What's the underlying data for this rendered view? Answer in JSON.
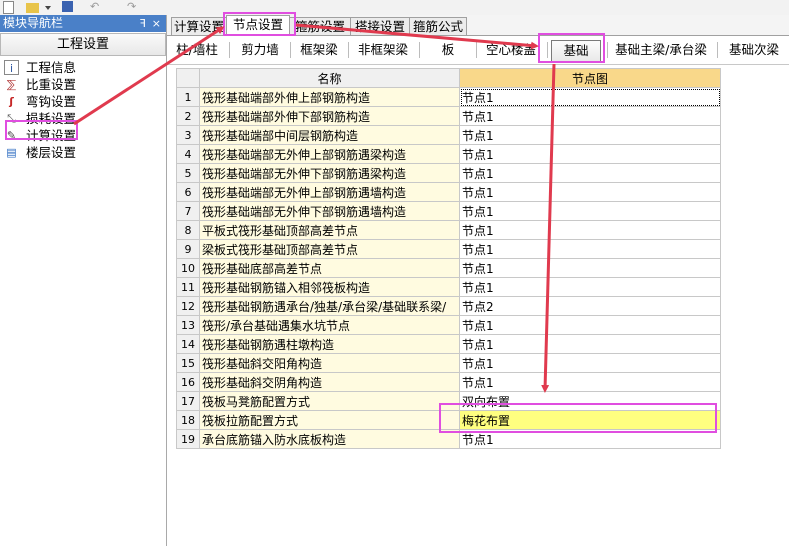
{
  "nav": {
    "title": "模块导航栏",
    "pin_glyph": "ꟻ",
    "close_glyph": "×",
    "header": "工程设置",
    "items": [
      {
        "label": "工程信息",
        "icon": "info-icon"
      },
      {
        "label": "比重设置",
        "icon": "weight-icon"
      },
      {
        "label": "弯钩设置",
        "icon": "hook-icon"
      },
      {
        "label": "损耗设置",
        "icon": "loss-icon"
      },
      {
        "label": "计算设置",
        "icon": "calc-icon"
      },
      {
        "label": "楼层设置",
        "icon": "floor-icon"
      }
    ]
  },
  "tabs_primary": [
    "计算设置",
    "节点设置",
    "箍筋设置",
    "搭接设置",
    "箍筋公式"
  ],
  "tabs_secondary": [
    "柱/墙柱",
    "剪力墙",
    "框架梁",
    "非框架梁",
    "板",
    "空心楼盖",
    "基础",
    "基础主梁/承台梁",
    "基础次梁"
  ],
  "table": {
    "headers": [
      "名称",
      "节点图"
    ],
    "rows": [
      {
        "num": "1",
        "name": "筏形基础端部外伸上部钢筋构造",
        "node": "节点1"
      },
      {
        "num": "2",
        "name": "筏形基础端部外伸下部钢筋构造",
        "node": "节点1"
      },
      {
        "num": "3",
        "name": "筏形基础端部中间层钢筋构造",
        "node": "节点1"
      },
      {
        "num": "4",
        "name": "筏形基础端部无外伸上部钢筋遇梁构造",
        "node": "节点1"
      },
      {
        "num": "5",
        "name": "筏形基础端部无外伸下部钢筋遇梁构造",
        "node": "节点1"
      },
      {
        "num": "6",
        "name": "筏形基础端部无外伸上部钢筋遇墙构造",
        "node": "节点1"
      },
      {
        "num": "7",
        "name": "筏形基础端部无外伸下部钢筋遇墙构造",
        "node": "节点1"
      },
      {
        "num": "8",
        "name": "平板式筏形基础顶部高差节点",
        "node": "节点1"
      },
      {
        "num": "9",
        "name": "梁板式筏形基础顶部高差节点",
        "node": "节点1"
      },
      {
        "num": "10",
        "name": "筏形基础底部高差节点",
        "node": "节点1"
      },
      {
        "num": "11",
        "name": "筏形基础钢筋锚入相邻筏板构造",
        "node": "节点1"
      },
      {
        "num": "12",
        "name": "筏形基础钢筋遇承台/独基/承台梁/基础联系梁/",
        "node": "节点2"
      },
      {
        "num": "13",
        "name": "筏形/承台基础遇集水坑节点",
        "node": "节点1"
      },
      {
        "num": "14",
        "name": "筏形基础钢筋遇柱墩构造",
        "node": "节点1"
      },
      {
        "num": "15",
        "name": "筏形基础斜交阳角构造",
        "node": "节点1"
      },
      {
        "num": "16",
        "name": "筏形基础斜交阴角构造",
        "node": "节点1"
      },
      {
        "num": "17",
        "name": "筏板马凳筋配置方式",
        "node": "双向布置"
      },
      {
        "num": "18",
        "name": "筏板拉筋配置方式",
        "node": "梅花布置"
      },
      {
        "num": "19",
        "name": "承台底筋锚入防水底板构造",
        "node": "节点1"
      }
    ]
  },
  "colors": {
    "highlight": "#e04ee0",
    "arrow": "#e03a4e",
    "nav_title_bg": "#4a80c8",
    "header_node_bg": "#f9d88a",
    "name_cell_bg": "#fffbe0",
    "selected_value_bg": "#ffff80"
  }
}
